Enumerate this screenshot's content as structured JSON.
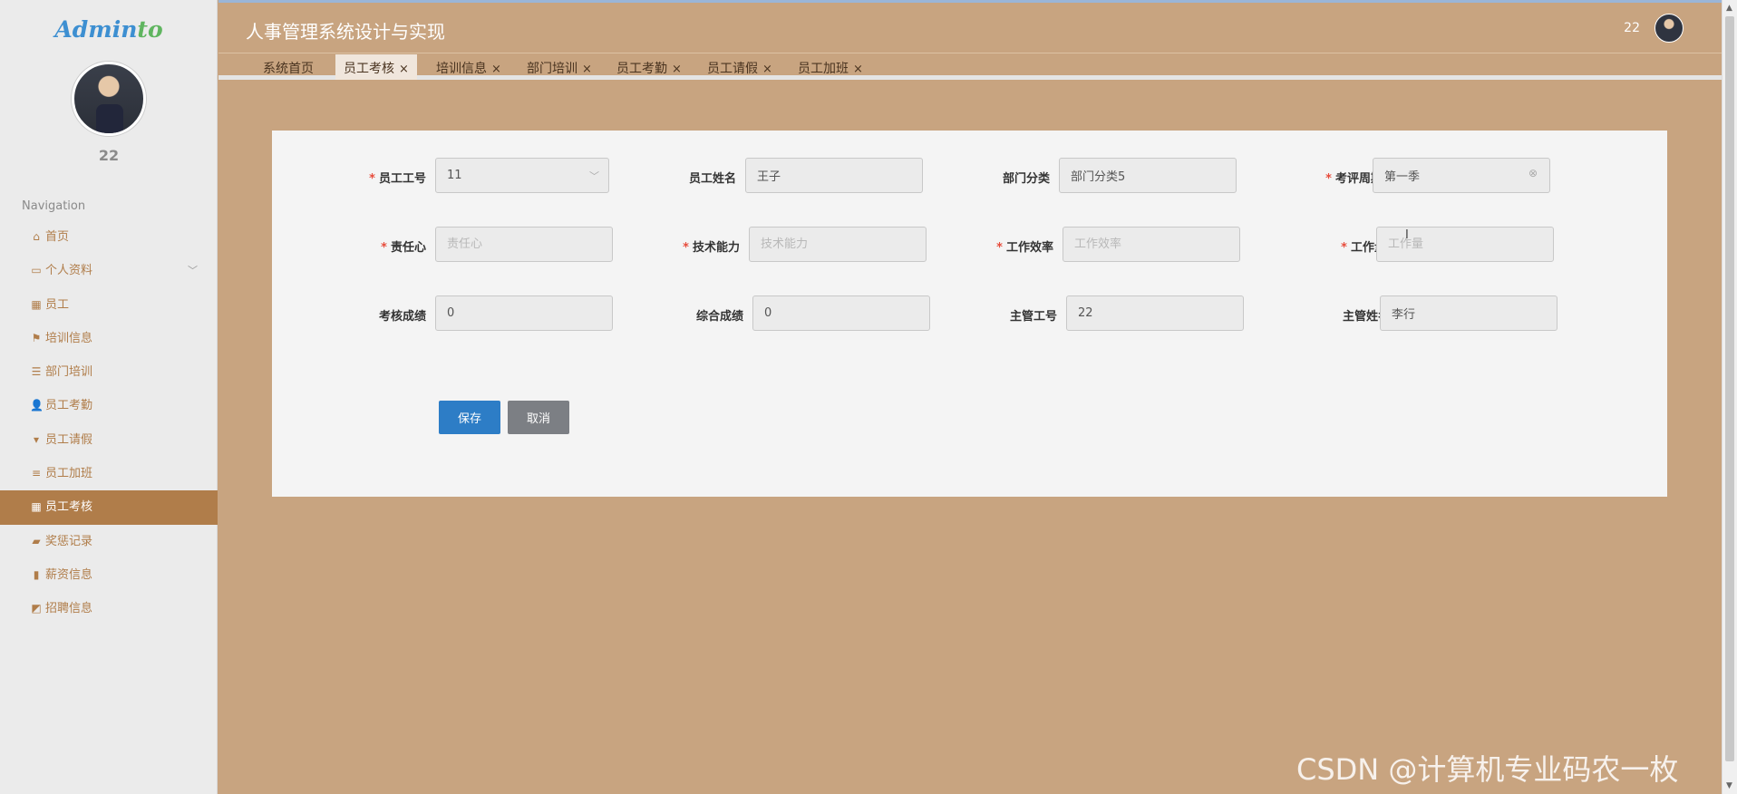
{
  "sidebar": {
    "logo_a": "Admin",
    "logo_b": "to",
    "username": "22",
    "nav_title": "Navigation",
    "items": [
      {
        "label": "首页",
        "icon": "home-icon"
      },
      {
        "label": "个人资料",
        "icon": "profile-card-icon"
      },
      {
        "label": "员工",
        "icon": "grid-icon"
      },
      {
        "label": "培训信息",
        "icon": "flag-icon"
      },
      {
        "label": "部门培训",
        "icon": "sliders-icon"
      },
      {
        "label": "员工考勤",
        "icon": "user-icon"
      },
      {
        "label": "员工请假",
        "icon": "stamp-icon"
      },
      {
        "label": "员工加班",
        "icon": "list-icon"
      },
      {
        "label": "员工考核",
        "icon": "grid-icon"
      },
      {
        "label": "奖惩记录",
        "icon": "thumbs-icon"
      },
      {
        "label": "薪资信息",
        "icon": "bar-chart-icon"
      },
      {
        "label": "招聘信息",
        "icon": "line-chart-icon"
      }
    ],
    "active_index": 8
  },
  "header": {
    "title": "人事管理系统设计与实现",
    "user": "22"
  },
  "tabs": [
    {
      "label": "系统首页",
      "closable": false
    },
    {
      "label": "员工考核",
      "closable": true
    },
    {
      "label": "培训信息",
      "closable": true
    },
    {
      "label": "部门培训",
      "closable": true
    },
    {
      "label": "员工考勤",
      "closable": true
    },
    {
      "label": "员工请假",
      "closable": true
    },
    {
      "label": "员工加班",
      "closable": true
    }
  ],
  "tab_close": "×",
  "form": {
    "employee_id": {
      "label": "员工工号",
      "value": "11",
      "required": true
    },
    "employee_name": {
      "label": "员工姓名",
      "value": "王子",
      "required": false
    },
    "department": {
      "label": "部门分类",
      "value": "部门分类5",
      "required": false
    },
    "period": {
      "label": "考评周期",
      "value": "第一季",
      "required": true
    },
    "responsibility": {
      "label": "责任心",
      "placeholder": "责任心",
      "required": true
    },
    "skill": {
      "label": "技术能力",
      "placeholder": "技术能力",
      "required": true
    },
    "efficiency": {
      "label": "工作效率",
      "placeholder": "工作效率",
      "required": true
    },
    "workload": {
      "label": "工作量",
      "placeholder": "工作量",
      "required": true
    },
    "score": {
      "label": "考核成绩",
      "value": "0"
    },
    "total_score": {
      "label": "综合成绩",
      "value": "0"
    },
    "manager_id": {
      "label": "主管工号",
      "value": "22"
    },
    "manager_name": {
      "label": "主管姓名",
      "value": "李行"
    },
    "required_mark": "*",
    "save_label": "保存",
    "cancel_label": "取消"
  },
  "watermark": "CSDN @计算机专业码农一枚",
  "colors": {
    "accent": "#b07d4a",
    "background": "#c8a480",
    "primary_button": "#2d7dc6",
    "secondary_button": "#7c7f84",
    "required": "#e74c3c"
  }
}
